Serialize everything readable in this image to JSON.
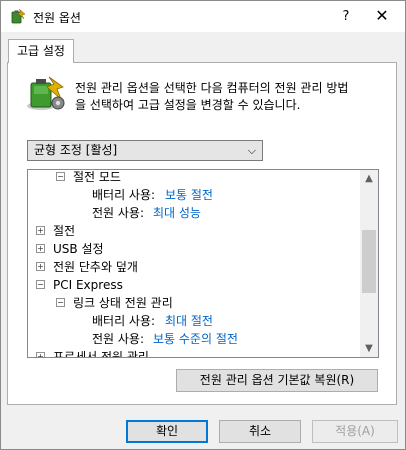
{
  "window": {
    "title": "전원 옵션",
    "help_label": "?",
    "close_label": "✕"
  },
  "tab": {
    "label": "고급 설정"
  },
  "description": {
    "line1": "전원 관리 옵션을 선택한 다음 컴퓨터의 전원 관리 방법",
    "line2": "을 선택하여 고급 설정을 변경할 수 있습니다."
  },
  "scheme": {
    "selected": "균형 조정 [활성]",
    "chevron": "⌵"
  },
  "tree": {
    "rows": [
      {
        "toggle": "−",
        "label": "절전 모드"
      },
      {
        "label": "배터리 사용:",
        "value": "보통 절전"
      },
      {
        "label": "전원 사용:",
        "value": "최대 성능"
      },
      {
        "toggle": "+",
        "label": "절전"
      },
      {
        "toggle": "+",
        "label": "USB 설정"
      },
      {
        "toggle": "+",
        "label": "전원 단추와 덮개"
      },
      {
        "toggle": "−",
        "label": "PCI Express"
      },
      {
        "toggle": "−",
        "label": "링크 상태 전원 관리"
      },
      {
        "label": "배터리 사용:",
        "value": "최대 절전"
      },
      {
        "label": "전원 사용:",
        "value": "보통 수준의 절전"
      },
      {
        "toggle": "+",
        "label": "프로세서 전원 관리"
      }
    ],
    "scroll_up": "▲",
    "scroll_down": "▼"
  },
  "buttons": {
    "restore": "전원 관리 옵션 기본값 복원(R)",
    "ok": "확인",
    "cancel": "취소",
    "apply": "적용(A)"
  },
  "colors": {
    "value_link": "#0066cc",
    "focus_border": "#0078d7"
  }
}
